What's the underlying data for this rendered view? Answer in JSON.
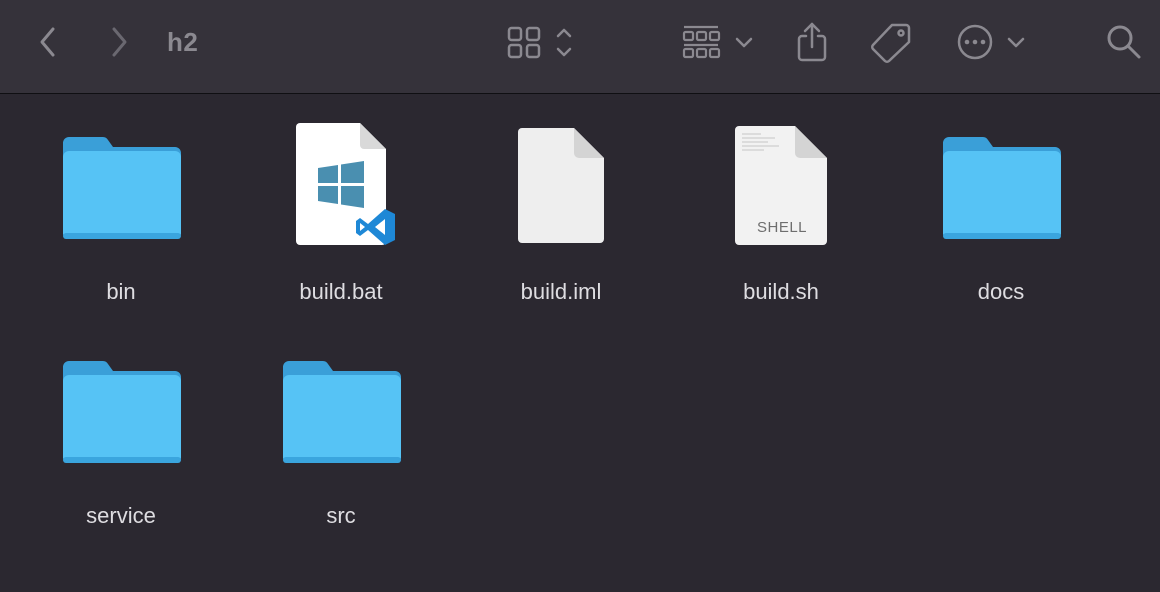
{
  "window": {
    "title": "h2"
  },
  "toolbar": {
    "back_icon": "chevron-left-icon",
    "forward_icon": "chevron-right-icon",
    "view_icon": "grid-view-icon",
    "view_stepper_icon": "up-down-chevron-icon",
    "group_icon": "group-by-icon",
    "group_dropdown_icon": "chevron-down-icon",
    "share_icon": "share-icon",
    "tag_icon": "tag-icon",
    "more_icon": "ellipsis-circle-icon",
    "more_dropdown_icon": "chevron-down-icon",
    "search_icon": "search-icon"
  },
  "files": [
    {
      "name": "bin",
      "kind": "folder",
      "icon": "folder-icon"
    },
    {
      "name": "build.bat",
      "kind": "document",
      "icon": "vscode-windows-file-icon"
    },
    {
      "name": "build.iml",
      "kind": "document",
      "icon": "blank-file-icon"
    },
    {
      "name": "build.sh",
      "kind": "document",
      "icon": "shell-script-file-icon",
      "badge": "SHELL"
    },
    {
      "name": "docs",
      "kind": "folder",
      "icon": "folder-icon"
    },
    {
      "name": "service",
      "kind": "folder",
      "icon": "folder-icon"
    },
    {
      "name": "src",
      "kind": "folder",
      "icon": "folder-icon"
    }
  ],
  "colors": {
    "window_bg": "#2b2830",
    "toolbar_bg": "#35323a",
    "toolbar_icon": "#8b8990",
    "label_text": "#dedde1",
    "folder_blue": "#56c3f5",
    "vscode_blue": "#1e88d6",
    "windows_logo": "#4a8fb0"
  }
}
